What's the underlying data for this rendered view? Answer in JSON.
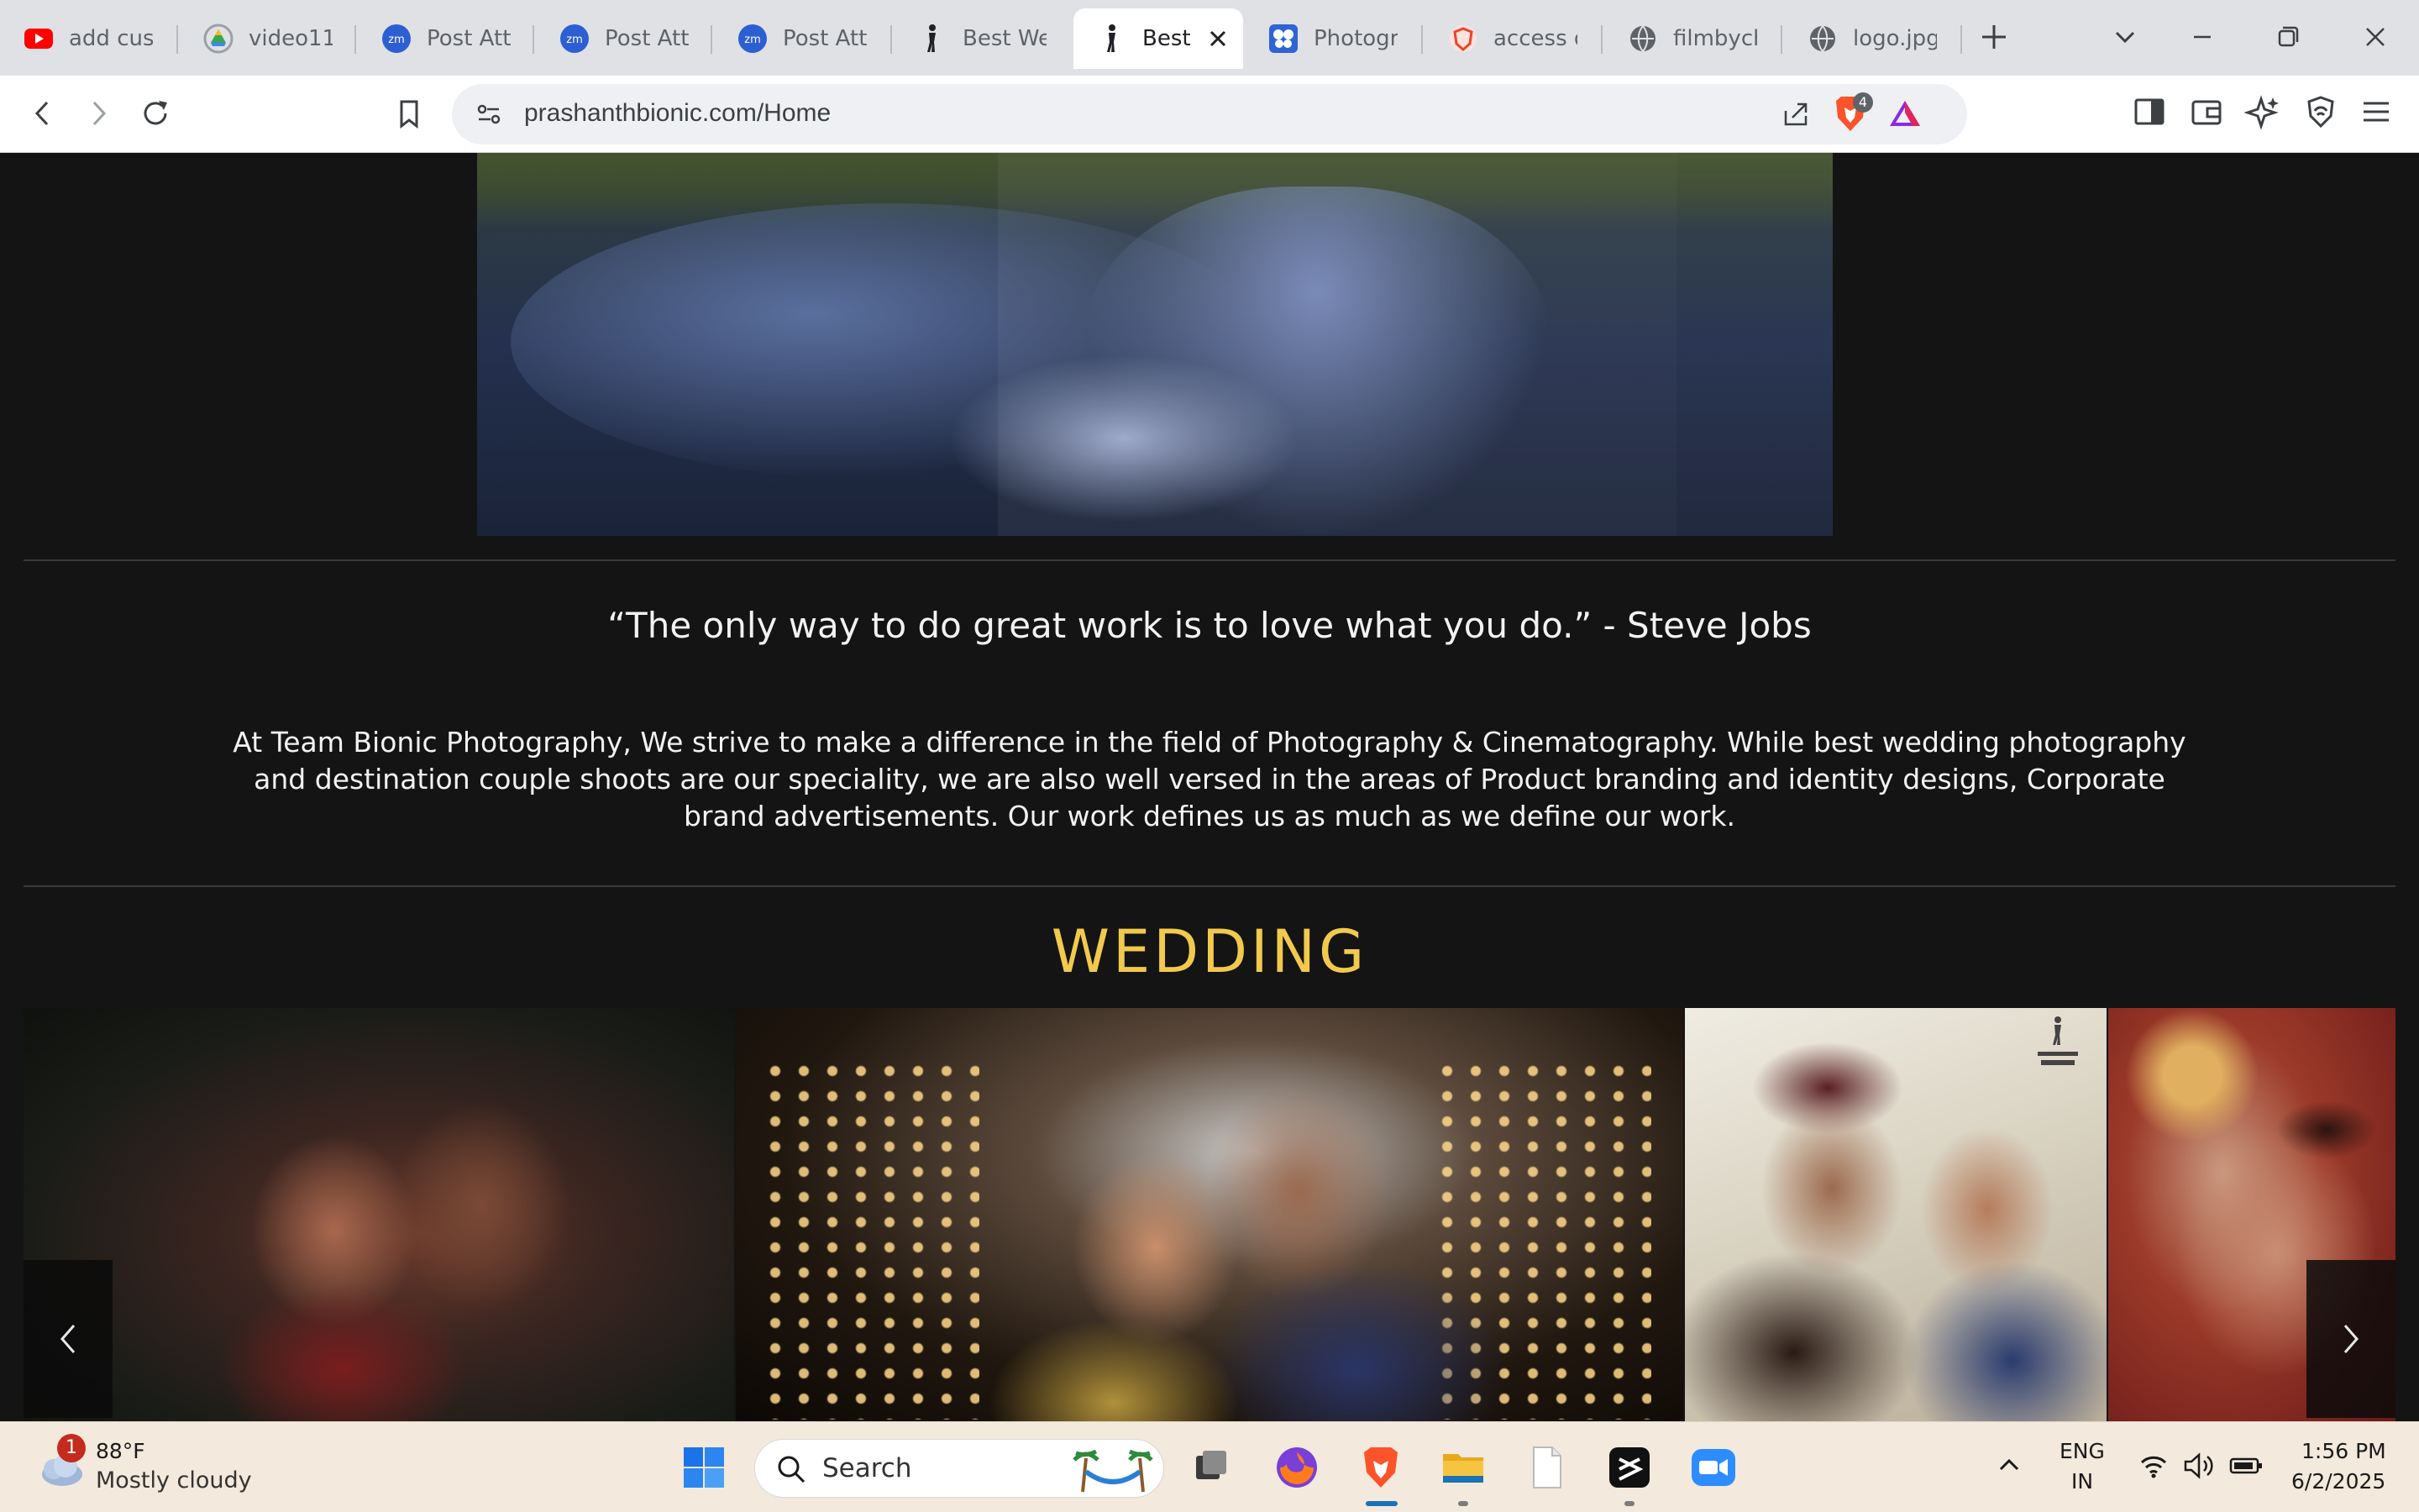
{
  "browser": {
    "tabs": [
      {
        "label": "add cust",
        "icon": "youtube-icon"
      },
      {
        "label": "video11",
        "icon": "google-drive-icon"
      },
      {
        "label": "Post Att",
        "icon": "zoom-icon"
      },
      {
        "label": "Post Att",
        "icon": "zoom-icon"
      },
      {
        "label": "Post Att",
        "icon": "zoom-icon"
      },
      {
        "label": "Best We",
        "icon": "bionic-logo-icon"
      },
      {
        "label": "Best",
        "icon": "bionic-logo-icon"
      },
      {
        "label": "Photogr",
        "icon": "butterfly-icon"
      },
      {
        "label": "access d",
        "icon": "shield-icon"
      },
      {
        "label": "filmbych",
        "icon": "globe-icon"
      },
      {
        "label": "logo.jpg",
        "icon": "globe-icon"
      }
    ],
    "active_tab": 6,
    "url": "prashanthbionic.com/Home",
    "shields_count": "4",
    "accent": "#fb542b"
  },
  "page": {
    "quote": "“The only way to do great work is to love what you do.” - Steve Jobs",
    "about": "At Team Bionic Photography, We strive to make a difference in the field of Photography & Cinematography.  While best wedding photography and destination couple shoots are our speciality, we are also well versed in the areas of Product branding and identity designs, Corporate brand advertisements. Our work defines us as much as we define our work.",
    "section_title": "WEDDING",
    "title_color": "#f1c94c",
    "background": "#141414"
  },
  "taskbar": {
    "weather_badge": "1",
    "temperature": "88°F",
    "condition": "Mostly cloudy",
    "search_label": "Search",
    "lang_line1": "ENG",
    "lang_line2": "IN",
    "time": "1:56 PM",
    "date": "6/2/2025"
  }
}
